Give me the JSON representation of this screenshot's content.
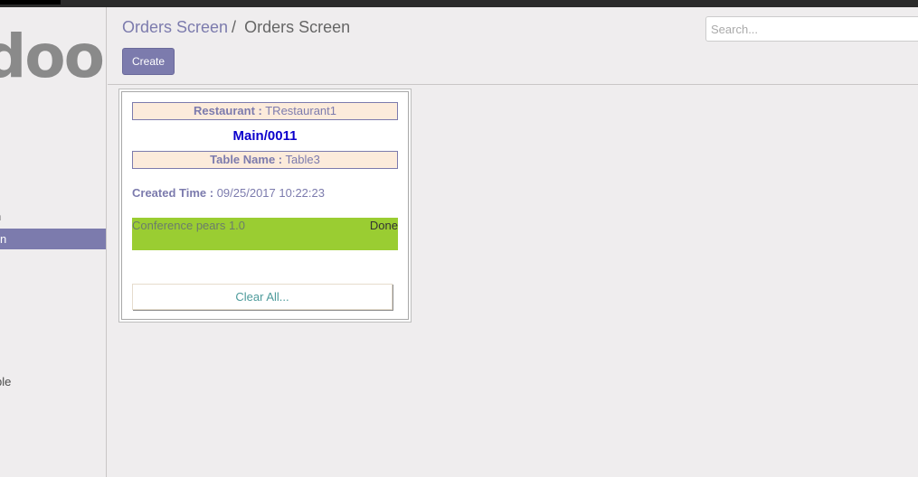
{
  "sidebar": {
    "logo": "doo",
    "items": [
      "n",
      "n",
      "ble"
    ]
  },
  "breadcrumb": {
    "parent": "Orders Screen",
    "separator": "/",
    "current": "Orders Screen"
  },
  "toolbar": {
    "create_label": "Create"
  },
  "search": {
    "placeholder": "Search...",
    "value": ""
  },
  "order": {
    "restaurant_label": "Restaurant :",
    "restaurant_value": "TRestaurant1",
    "number": "Main/0011",
    "table_label": "Table Name :",
    "table_value": "Table3",
    "created_label": "Created Time :",
    "created_value": "09/25/2017 10:22:23",
    "lines": [
      {
        "product": "Conference pears 1.0",
        "status": "Done"
      }
    ],
    "clear_label": "Clear All..."
  },
  "colors": {
    "brand": "#7c7bad",
    "done_line": "#9acd32",
    "order_number": "#0b00cc",
    "info_box_bg": "#fcebdb"
  }
}
